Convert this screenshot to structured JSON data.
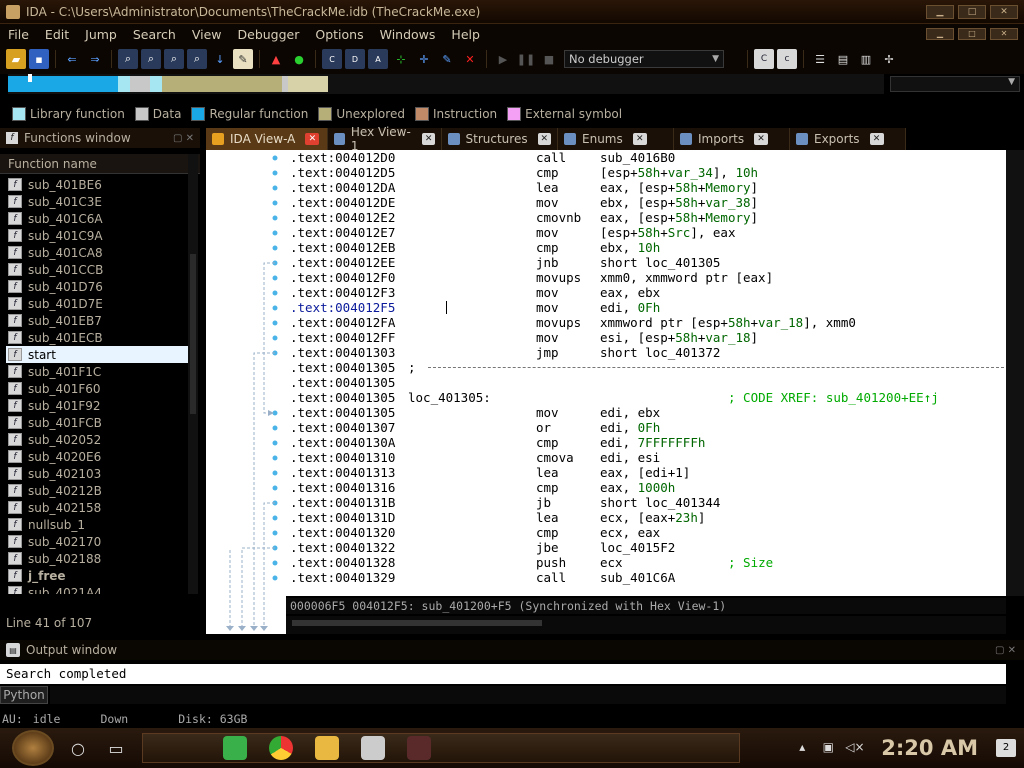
{
  "window": {
    "title": "IDA - C:\\Users\\Administrator\\Documents\\TheCrackMe.idb (TheCrackMe.exe)"
  },
  "menu": [
    "File",
    "Edit",
    "Jump",
    "Search",
    "View",
    "Debugger",
    "Options",
    "Windows",
    "Help"
  ],
  "toolbar": {
    "debugger_label": "No debugger"
  },
  "legend": [
    {
      "label": "Library function",
      "color": "#a6e6f2"
    },
    {
      "label": "Data",
      "color": "#c8c8c8"
    },
    {
      "label": "Regular function",
      "color": "#1aa8e6"
    },
    {
      "label": "Unexplored",
      "color": "#b6b078"
    },
    {
      "label": "Instruction",
      "color": "#c08a68"
    },
    {
      "label": "External symbol",
      "color": "#f4a0f4"
    }
  ],
  "functions_window": {
    "title": "Functions window",
    "column": "Function name",
    "items": [
      "sub_401BE6",
      "sub_401C3E",
      "sub_401C6A",
      "sub_401C9A",
      "sub_401CA8",
      "sub_401CCB",
      "sub_401D76",
      "sub_401D7E",
      "sub_401EB7",
      "sub_401ECB",
      "start",
      "sub_401F1C",
      "sub_401F60",
      "sub_401F92",
      "sub_401FCB",
      "sub_402052",
      "sub_4020E6",
      "sub_402103",
      "sub_40212B",
      "sub_402158",
      "nullsub_1",
      "sub_402170",
      "sub_402188",
      "j_free",
      "sub_4021A4"
    ],
    "selected": "start",
    "line_info": "Line 41 of 107"
  },
  "tabs": [
    {
      "label": "IDA View-A",
      "active": true
    },
    {
      "label": "Hex View-1",
      "active": false
    },
    {
      "label": "Structures",
      "active": false
    },
    {
      "label": "Enums",
      "active": false
    },
    {
      "label": "Imports",
      "active": false
    },
    {
      "label": "Exports",
      "active": false
    }
  ],
  "code": [
    {
      "addr": ".text:004012D0",
      "mn": "call",
      "op": "sub_4016B0"
    },
    {
      "addr": ".text:004012D5",
      "mn": "cmp",
      "op": "[esp+58h+var_34], 10h"
    },
    {
      "addr": ".text:004012DA",
      "mn": "lea",
      "op": "eax, [esp+58h+Memory]"
    },
    {
      "addr": ".text:004012DE",
      "mn": "mov",
      "op": "ebx, [esp+58h+var_38]"
    },
    {
      "addr": ".text:004012E2",
      "mn": "cmovnb",
      "op": "eax, [esp+58h+Memory]"
    },
    {
      "addr": ".text:004012E7",
      "mn": "mov",
      "op": "[esp+58h+Src], eax"
    },
    {
      "addr": ".text:004012EB",
      "mn": "cmp",
      "op": "ebx, 10h"
    },
    {
      "addr": ".text:004012EE",
      "mn": "jnb",
      "op": "short loc_401305"
    },
    {
      "addr": ".text:004012F0",
      "mn": "movups",
      "op": "xmm0, xmmword ptr [eax]"
    },
    {
      "addr": ".text:004012F3",
      "mn": "mov",
      "op": "eax, ebx"
    },
    {
      "addr": ".text:004012F5",
      "mn": "mov",
      "op": "edi, 0Fh",
      "current": true
    },
    {
      "addr": ".text:004012FA",
      "mn": "movups",
      "op": "xmmword ptr [esp+58h+var_18], xmm0"
    },
    {
      "addr": ".text:004012FF",
      "mn": "mov",
      "op": "esi, [esp+58h+var_18]"
    },
    {
      "addr": ".text:00401303",
      "mn": "jmp",
      "op": "short loc_401372"
    },
    {
      "addr": ".text:00401305",
      "sep": true,
      "lbl": ";"
    },
    {
      "addr": ".text:00401305"
    },
    {
      "addr": ".text:00401305",
      "lbl": "loc_401305:",
      "cm": "; CODE XREF: sub_401200+EE↑j"
    },
    {
      "addr": ".text:00401305",
      "mn": "mov",
      "op": "edi, ebx"
    },
    {
      "addr": ".text:00401307",
      "mn": "or",
      "op": "edi, 0Fh"
    },
    {
      "addr": ".text:0040130A",
      "mn": "cmp",
      "op": "edi, 7FFFFFFFh"
    },
    {
      "addr": ".text:00401310",
      "mn": "cmova",
      "op": "edi, esi"
    },
    {
      "addr": ".text:00401313",
      "mn": "lea",
      "op": "eax, [edi+1]"
    },
    {
      "addr": ".text:00401316",
      "mn": "cmp",
      "op": "eax, 1000h"
    },
    {
      "addr": ".text:0040131B",
      "mn": "jb",
      "op": "short loc_401344"
    },
    {
      "addr": ".text:0040131D",
      "mn": "lea",
      "op": "ecx, [eax+23h]"
    },
    {
      "addr": ".text:00401320",
      "mn": "cmp",
      "op": "ecx, eax"
    },
    {
      "addr": ".text:00401322",
      "mn": "jbe",
      "op": "loc_4015F2"
    },
    {
      "addr": ".text:00401328",
      "mn": "push",
      "op": "ecx",
      "cm": "; Size"
    },
    {
      "addr": ".text:00401329",
      "mn": "call",
      "op": "sub_401C6A"
    }
  ],
  "status_line": "000006F5 004012F5: sub_401200+F5 (Synchronized with Hex View-1)",
  "output": {
    "title": "Output window",
    "text": "Search completed",
    "tab": "Python"
  },
  "au_bar": {
    "au": "AU:",
    "state": "idle",
    "dir": "Down",
    "disk": "Disk: 63GB"
  },
  "taskbar": {
    "clock": "2:20 AM",
    "notifications": "2"
  }
}
